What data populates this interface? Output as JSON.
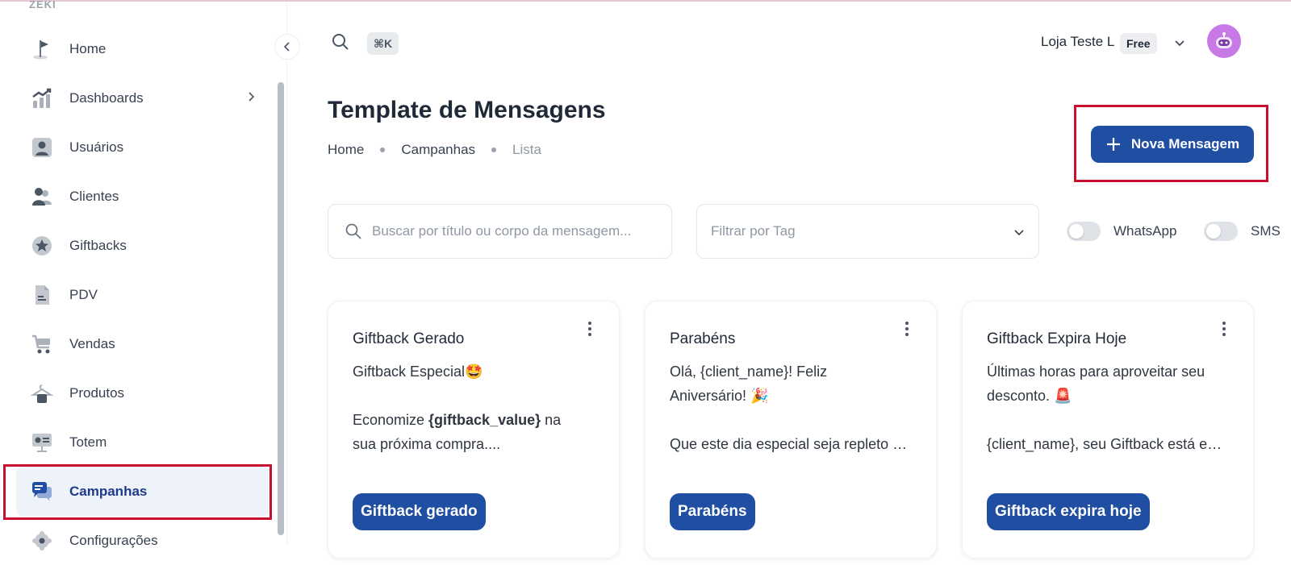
{
  "app": {
    "logo_text": "ZEKI"
  },
  "sidebar": {
    "items": [
      {
        "label": "Home",
        "icon": "flag-icon"
      },
      {
        "label": "Dashboards",
        "icon": "chart-icon"
      },
      {
        "label": "Usuários",
        "icon": "user-icon"
      },
      {
        "label": "Clientes",
        "icon": "users-icon"
      },
      {
        "label": "Giftbacks",
        "icon": "star-icon"
      },
      {
        "label": "PDV",
        "icon": "document-icon"
      },
      {
        "label": "Vendas",
        "icon": "cart-icon"
      },
      {
        "label": "Produtos",
        "icon": "hanger-icon"
      },
      {
        "label": "Totem",
        "icon": "kiosk-icon"
      },
      {
        "label": "Campanhas",
        "icon": "chat-icon",
        "active": true
      },
      {
        "label": "Configurações",
        "icon": "gear-icon"
      }
    ]
  },
  "header": {
    "shortcut_label": "⌘K",
    "store_name": "Loja Teste L",
    "plan_badge": "Free"
  },
  "page": {
    "title": "Template de Mensagens",
    "breadcrumb": [
      "Home",
      "Campanhas",
      "Lista"
    ],
    "new_button_label": "Nova Mensagem"
  },
  "filters": {
    "search_placeholder": "Buscar por título ou corpo da mensagem...",
    "tag_placeholder": "Filtrar por Tag",
    "toggle_whatsapp_label": "WhatsApp",
    "toggle_whatsapp_on": false,
    "toggle_sms_label": "SMS",
    "toggle_sms_on": false
  },
  "cards": [
    {
      "title": "Giftback Gerado",
      "line1": "Giftback Especial🤩",
      "line2": "",
      "line3_pre": "Economize ",
      "line3_bold": "{giftback_value}",
      "line3_post": " na",
      "line4": "sua próxima compra....",
      "tag": "Giftback gerado"
    },
    {
      "title": "Parabéns",
      "line1": "Olá, {client_name}! Feliz",
      "line2": "Aniversário! 🎉",
      "line3_pre": "",
      "line3_bold": "",
      "line3_post": "",
      "line4": "Que este dia especial seja repleto de alegrias",
      "tag": "Parabéns"
    },
    {
      "title": "Giftback Expira Hoje",
      "line1": "Últimas horas para aproveitar seu",
      "line2": "desconto. 🚨",
      "line3_pre": "",
      "line3_bold": "",
      "line3_post": "",
      "line4": "{client_name}, seu Giftback está expirando",
      "tag": "Giftback expira hoje"
    }
  ],
  "colors": {
    "primary": "#1f4ea3",
    "highlight": "#c8102e",
    "active_bg": "#eef2f9"
  }
}
